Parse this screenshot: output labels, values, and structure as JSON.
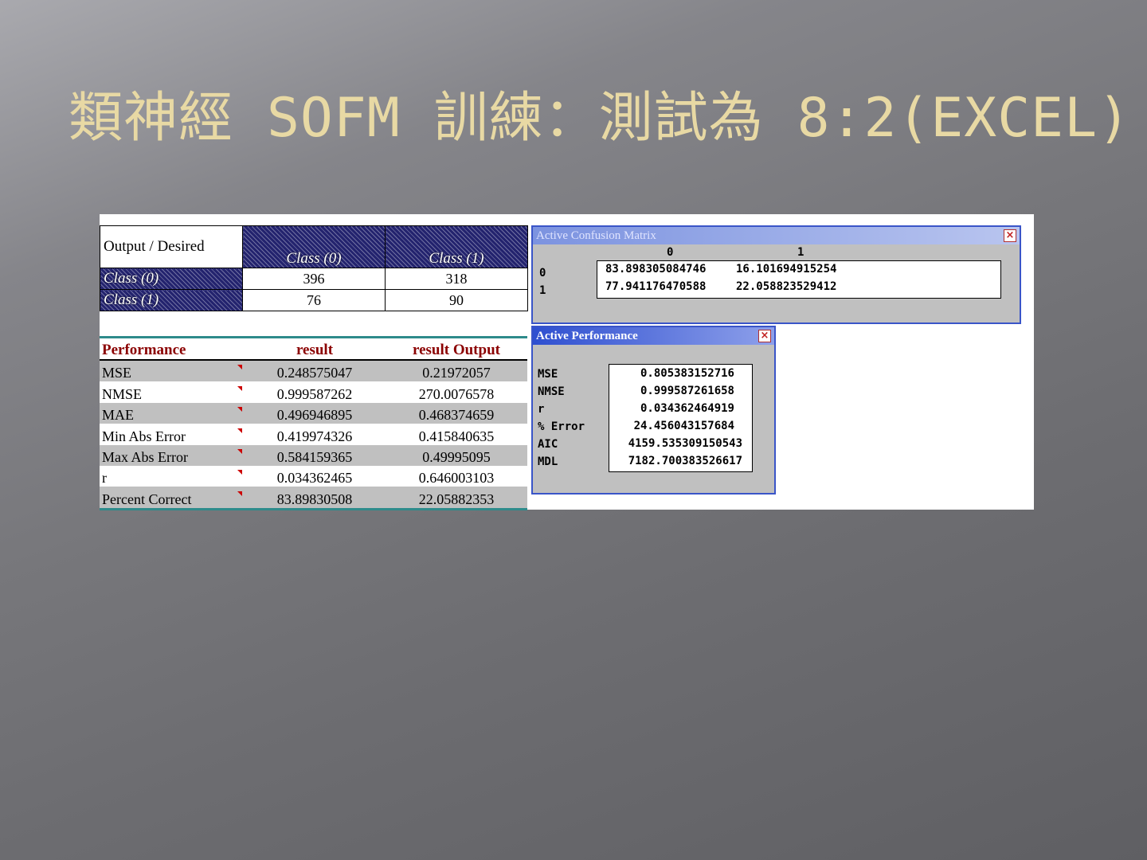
{
  "slide": {
    "title": "類神經 SOFM  訓練：測試為 8:2(EXCEL)"
  },
  "excel_confusion": {
    "corner_label": "Output / Desired",
    "col_headers": [
      "Class (0)",
      "Class (1)"
    ],
    "rows": [
      {
        "label": "Class (0)",
        "values": [
          "396",
          "318"
        ]
      },
      {
        "label": "Class (1)",
        "values": [
          "76",
          "90"
        ]
      }
    ]
  },
  "excel_performance": {
    "headers": [
      "Performance",
      "result",
      "result Output"
    ],
    "rows": [
      {
        "label": "MSE",
        "result": "0.248575047",
        "output": "0.21972057"
      },
      {
        "label": "NMSE",
        "result": "0.999587262",
        "output": "270.0076578"
      },
      {
        "label": "MAE",
        "result": "0.496946895",
        "output": "0.468374659"
      },
      {
        "label": "Min Abs Error",
        "result": "0.419974326",
        "output": "0.415840635"
      },
      {
        "label": "Max Abs Error",
        "result": "0.584159365",
        "output": "0.49995095"
      },
      {
        "label": "r",
        "result": "0.034362465",
        "output": "0.646003103"
      },
      {
        "label": "Percent Correct",
        "result": "83.89830508",
        "output": "22.05882353"
      }
    ]
  },
  "confusion_window": {
    "title": "Active Confusion Matrix",
    "col_labels": [
      "0",
      "1"
    ],
    "row_labels": [
      "0",
      "1"
    ],
    "cells": [
      [
        "83.898305084746",
        "16.101694915254"
      ],
      [
        "77.941176470588",
        "22.058823529412"
      ]
    ]
  },
  "performance_window": {
    "title": "Active Performance",
    "rows": [
      {
        "label": "MSE",
        "value": "0.805383152716"
      },
      {
        "label": "NMSE",
        "value": "0.999587261658"
      },
      {
        "label": "r",
        "value": "0.034362464919"
      },
      {
        "label": "% Error",
        "value": "24.456043157684"
      },
      {
        "label": "AIC",
        "value": "4159.535309150543"
      },
      {
        "label": "MDL",
        "value": "7182.700383526617"
      }
    ]
  },
  "icons": {
    "close": "close-icon"
  }
}
